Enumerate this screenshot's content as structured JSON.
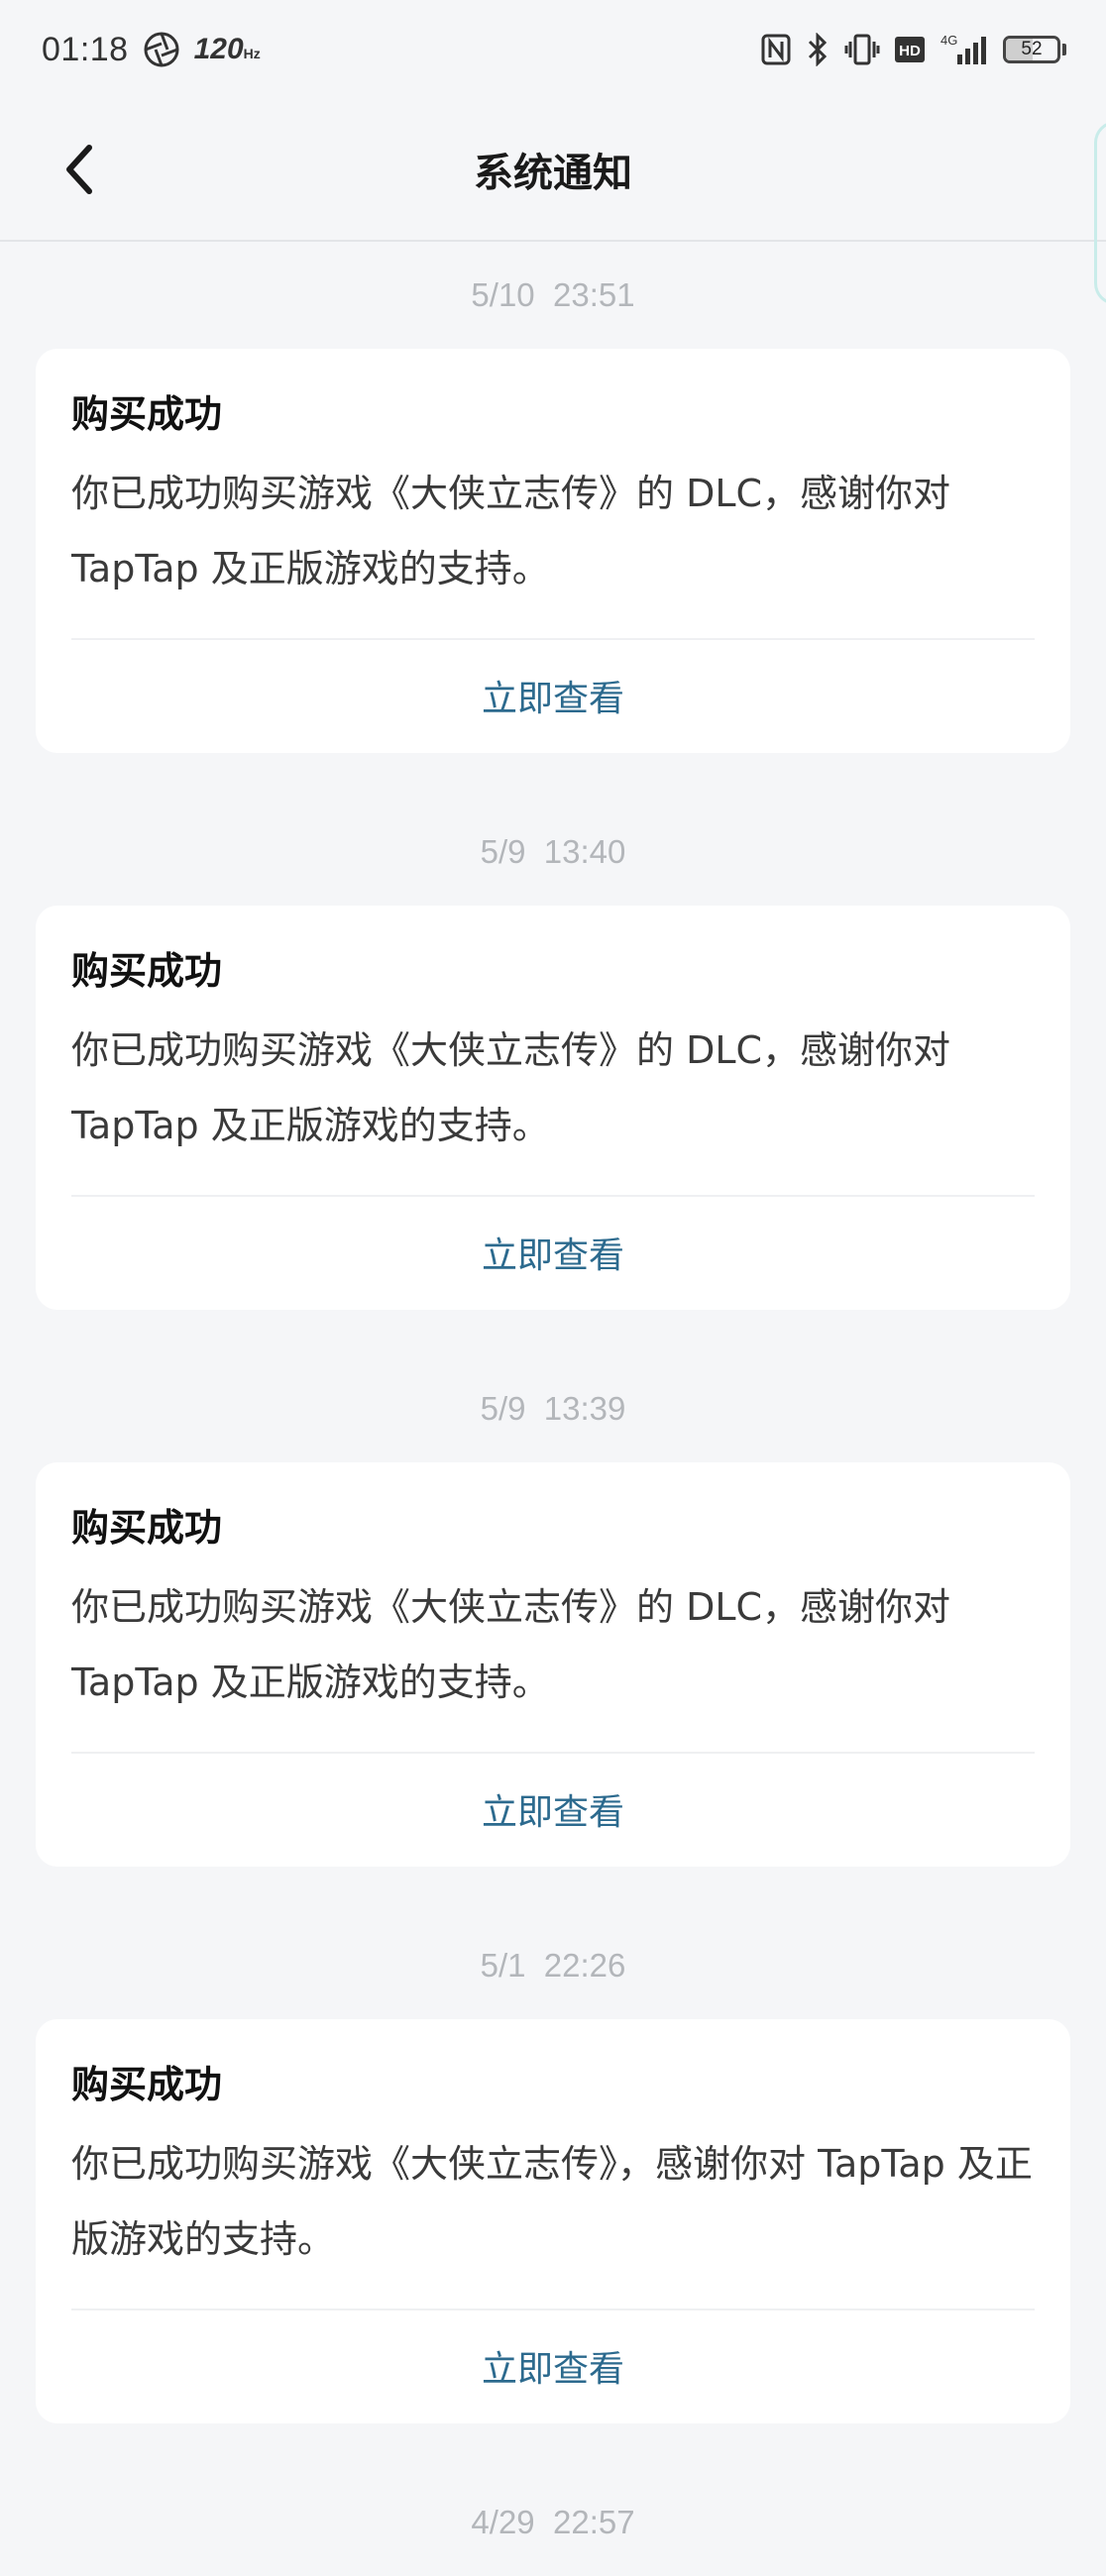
{
  "status_bar": {
    "time": "01:18",
    "refresh_rate": "120",
    "refresh_unit": "Hz",
    "network": "4G",
    "hd_label": "HD",
    "battery": "52",
    "battery_level": 0.52
  },
  "header": {
    "title": "系统通知"
  },
  "notices": [
    {
      "time": "5/10  23:51",
      "title": "购买成功",
      "body": "你已成功购买游戏《大侠立志传》的 DLC，感谢你对 TapTap 及正版游戏的支持。",
      "action": "立即查看"
    },
    {
      "time": "5/9  13:40",
      "title": "购买成功",
      "body": "你已成功购买游戏《大侠立志传》的 DLC，感谢你对 TapTap 及正版游戏的支持。",
      "action": "立即查看"
    },
    {
      "time": "5/9  13:39",
      "title": "购买成功",
      "body": "你已成功购买游戏《大侠立志传》的 DLC，感谢你对 TapTap 及正版游戏的支持。",
      "action": "立即查看"
    },
    {
      "time": "5/1  22:26",
      "title": "购买成功",
      "body": "你已成功购买游戏《大侠立志传》，感谢你对 TapTap 及正版游戏的支持。",
      "action": "立即查看"
    },
    {
      "time": "4/29  22:57"
    }
  ],
  "colors": {
    "background": "#f5f6f8",
    "card": "#ffffff",
    "link": "#2c6a8e",
    "timestamp": "#b3b6ba"
  }
}
